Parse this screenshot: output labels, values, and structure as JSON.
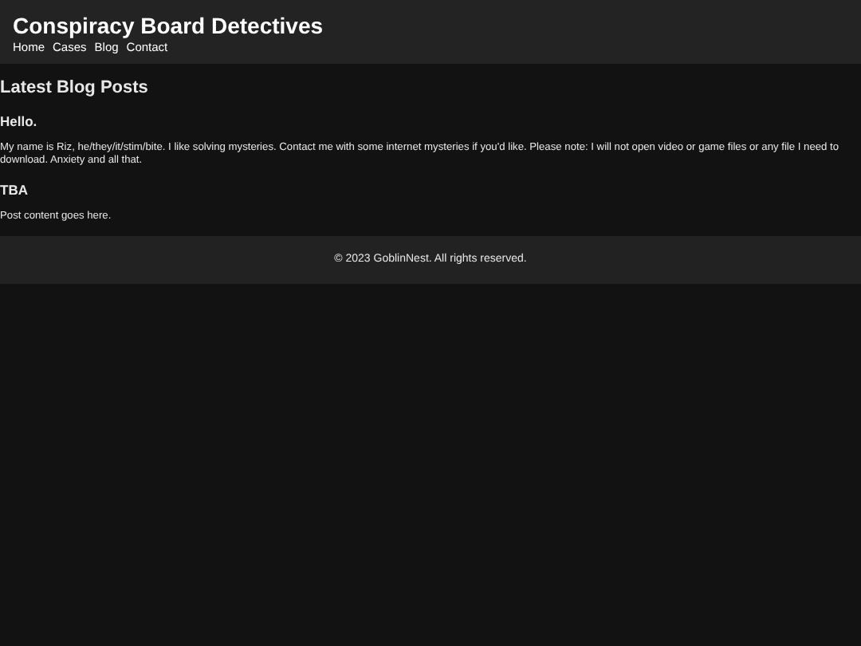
{
  "site_title": "Conspiracy Board Detectives",
  "nav": [
    "Home",
    "Cases",
    "Blog",
    "Contact"
  ],
  "section_title": "Latest Blog Posts",
  "posts": [
    {
      "title": "Hello.",
      "body": "My name is Riz, he/they/it/stim/bite. I like solving mysteries. Contact me with some internet mysteries if you'd like. Please note: I will not open video or game files or any file I need to download. Anxiety and all that."
    },
    {
      "title": "TBA",
      "body": "Post content goes here."
    }
  ],
  "footer": "© 2023 GoblinNest. All rights reserved."
}
